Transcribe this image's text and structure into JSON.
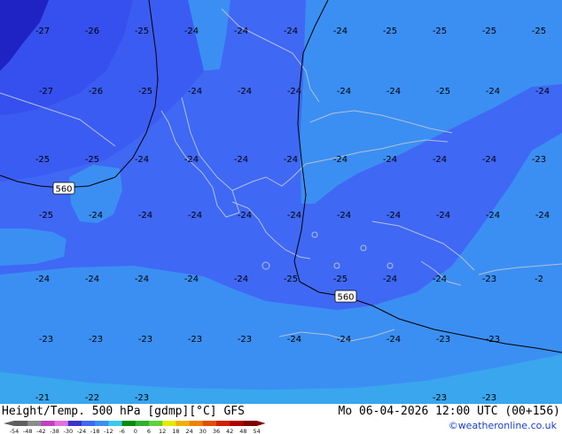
{
  "colors": {
    "band_m27": "#1f23c4",
    "band_m26": "#3650ef",
    "band_m25": "#3b5cf2",
    "band_m24": "#3f68f5",
    "band_m23": "#3b8ff2",
    "band_m22": "#3aa6ee",
    "coast": "#b4bfd6",
    "isoline": "#000000"
  },
  "map": {
    "temperature_labels": [
      {
        "t": "-27",
        "c": 0,
        "r": 0
      },
      {
        "t": "-26",
        "c": 1,
        "r": 0
      },
      {
        "t": "-25",
        "c": 2,
        "r": 0
      },
      {
        "t": "-24",
        "c": 3,
        "r": 0
      },
      {
        "t": "-24",
        "c": 4,
        "r": 0
      },
      {
        "t": "-24",
        "c": 5,
        "r": 0
      },
      {
        "t": "-24",
        "c": 6,
        "r": 0
      },
      {
        "t": "-25",
        "c": 7,
        "r": 0
      },
      {
        "t": "-25",
        "c": 8,
        "r": 0
      },
      {
        "t": "-25",
        "c": 9,
        "r": 0
      },
      {
        "t": "-25",
        "c": 10,
        "r": 0
      },
      {
        "t": "-27",
        "c": 0,
        "r": 1
      },
      {
        "t": "-26",
        "c": 1,
        "r": 1
      },
      {
        "t": "-25",
        "c": 2,
        "r": 1
      },
      {
        "t": "-24",
        "c": 3,
        "r": 1
      },
      {
        "t": "-24",
        "c": 4,
        "r": 1
      },
      {
        "t": "-24",
        "c": 5,
        "r": 1
      },
      {
        "t": "-24",
        "c": 6,
        "r": 1
      },
      {
        "t": "-24",
        "c": 7,
        "r": 1
      },
      {
        "t": "-25",
        "c": 8,
        "r": 1
      },
      {
        "t": "-24",
        "c": 9,
        "r": 1
      },
      {
        "t": "-24",
        "c": 10,
        "r": 1
      },
      {
        "t": "-25",
        "c": 0,
        "r": 2
      },
      {
        "t": "-25",
        "c": 1,
        "r": 2
      },
      {
        "t": "-24",
        "c": 2,
        "r": 2
      },
      {
        "t": "-24",
        "c": 3,
        "r": 2
      },
      {
        "t": "-24",
        "c": 4,
        "r": 2
      },
      {
        "t": "-24",
        "c": 5,
        "r": 2
      },
      {
        "t": "-24",
        "c": 6,
        "r": 2
      },
      {
        "t": "-24",
        "c": 7,
        "r": 2
      },
      {
        "t": "-24",
        "c": 8,
        "r": 2
      },
      {
        "t": "-24",
        "c": 9,
        "r": 2
      },
      {
        "t": "-23",
        "c": 10,
        "r": 2
      },
      {
        "t": "-25",
        "c": 0,
        "r": 3
      },
      {
        "t": "-24",
        "c": 1,
        "r": 3
      },
      {
        "t": "-24",
        "c": 2,
        "r": 3
      },
      {
        "t": "-24",
        "c": 3,
        "r": 3
      },
      {
        "t": "-24",
        "c": 4,
        "r": 3
      },
      {
        "t": "-24",
        "c": 5,
        "r": 3
      },
      {
        "t": "-24",
        "c": 6,
        "r": 3
      },
      {
        "t": "-24",
        "c": 7,
        "r": 3
      },
      {
        "t": "-24",
        "c": 8,
        "r": 3
      },
      {
        "t": "-24",
        "c": 9,
        "r": 3
      },
      {
        "t": "-24",
        "c": 10,
        "r": 3
      },
      {
        "t": "-24",
        "c": 0,
        "r": 4
      },
      {
        "t": "-24",
        "c": 1,
        "r": 4
      },
      {
        "t": "-24",
        "c": 2,
        "r": 4
      },
      {
        "t": "-24",
        "c": 3,
        "r": 4
      },
      {
        "t": "-24",
        "c": 4,
        "r": 4
      },
      {
        "t": "-25",
        "c": 5,
        "r": 4
      },
      {
        "t": "-25",
        "c": 6,
        "r": 4
      },
      {
        "t": "-24",
        "c": 7,
        "r": 4
      },
      {
        "t": "-24",
        "c": 8,
        "r": 4
      },
      {
        "t": "-23",
        "c": 9,
        "r": 4
      },
      {
        "t": "-2",
        "c": 10,
        "r": 4
      },
      {
        "t": "-23",
        "c": 0,
        "r": 5
      },
      {
        "t": "-23",
        "c": 1,
        "r": 5
      },
      {
        "t": "-23",
        "c": 2,
        "r": 5
      },
      {
        "t": "-23",
        "c": 3,
        "r": 5
      },
      {
        "t": "-23",
        "c": 4,
        "r": 5
      },
      {
        "t": "-24",
        "c": 5,
        "r": 5
      },
      {
        "t": "-24",
        "c": 6,
        "r": 5
      },
      {
        "t": "-24",
        "c": 7,
        "r": 5
      },
      {
        "t": "-23",
        "c": 8,
        "r": 5
      },
      {
        "t": "-23",
        "c": 9,
        "r": 5
      },
      {
        "t": "-21",
        "c": 0,
        "r": 6
      },
      {
        "t": "-22",
        "c": 1,
        "r": 6
      },
      {
        "t": "-23",
        "c": 2,
        "r": 6
      },
      {
        "t": "-23",
        "c": 8,
        "r": 6
      },
      {
        "t": "-23",
        "c": 9,
        "r": 6
      }
    ],
    "isolines": [
      {
        "label": "560",
        "which": 0
      },
      {
        "label": "560",
        "which": 1
      }
    ]
  },
  "footer": {
    "title": "Height/Temp. 500 hPa [gdmp][°C] GFS",
    "time": "Mo 06-04-2026 12:00 UTC (00+156)",
    "credit": "©weatheronline.co.uk",
    "scale_values": [
      "-54",
      "-48",
      "-42",
      "-38",
      "-30",
      "-24",
      "-18",
      "-12",
      "-6",
      "0",
      "6",
      "12",
      "18",
      "24",
      "30",
      "36",
      "42",
      "48",
      "54"
    ],
    "scale_colors": [
      "#5f5f5f",
      "#8c8c8c",
      "#c040c0",
      "#e070e0",
      "#3c32c8",
      "#3f68f5",
      "#3b8ff2",
      "#38c8f0",
      "#0a8a0a",
      "#30b030",
      "#60d040",
      "#e8e800",
      "#f0b000",
      "#f08000",
      "#e05000",
      "#d02000",
      "#b00000",
      "#800000"
    ]
  }
}
